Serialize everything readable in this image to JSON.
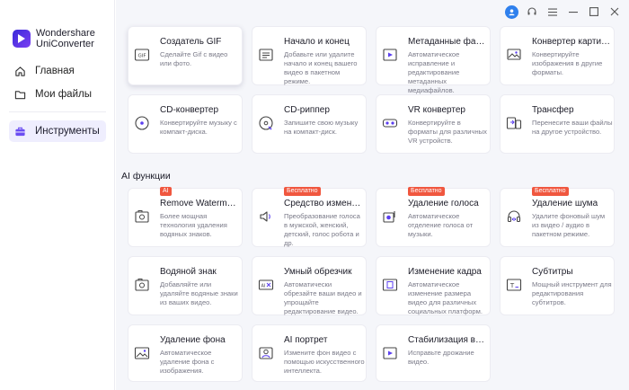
{
  "app": {
    "brand_line1": "Wondershare",
    "brand_line2": "UniConverter"
  },
  "sidebar": {
    "items": [
      {
        "label": "Главная",
        "icon": "home-icon"
      },
      {
        "label": "Мои файлы",
        "icon": "folder-icon"
      },
      {
        "label": "Инструменты",
        "icon": "toolbox-icon",
        "active": true
      }
    ]
  },
  "titlebar": {
    "icons": [
      "avatar-icon",
      "headset-icon",
      "menu-icon",
      "minimize-icon",
      "maximize-icon",
      "close-icon"
    ]
  },
  "tools": [
    {
      "title": "Создатель GIF",
      "desc": "Сделайте Gif с видео или фото.",
      "icon": "gif-icon"
    },
    {
      "title": "Начало и конец",
      "desc": "Добавьте или удалите начало и конец вашего видео в пакетном режиме.",
      "icon": "intro-outro-icon"
    },
    {
      "title": "Метаданные файла",
      "desc": "Автоматическое исправление и редактирование метаданных медиафайлов.",
      "icon": "metadata-icon"
    },
    {
      "title": "Конвертер картинок",
      "desc": "Конвертируйте изображения в другие форматы.",
      "icon": "image-convert-icon"
    },
    {
      "title": "CD-конвертер",
      "desc": "Конвертируйте музыку с компакт-диска.",
      "icon": "cd-convert-icon"
    },
    {
      "title": "CD-риппер",
      "desc": "Запишите свою музыку на компакт-диск.",
      "icon": "cd-ripper-icon"
    },
    {
      "title": "VR конвертер",
      "desc": "Конвертируйте в форматы для различных VR устройств.",
      "icon": "vr-icon"
    },
    {
      "title": "Трансфер",
      "desc": "Перенесите ваши файлы на другое устройство.",
      "icon": "transfer-icon"
    }
  ],
  "ai_section": {
    "title": "AI функции",
    "badge_ai": "AI",
    "badge_free": "Бесплатно",
    "tools": [
      {
        "title": "Remove Watermark",
        "title_display": "Remove Watermar...",
        "desc": "Более мощная технология удаления водяных знаков.",
        "icon": "watermark-remove-icon",
        "badge": "ai"
      },
      {
        "title": "Средство изменения голоса",
        "title_display": "Средство изменен...",
        "desc": "Преобразование голоса в мужской, женский, детский, голос робота и др.",
        "icon": "voice-changer-icon",
        "badge": "free"
      },
      {
        "title": "Удаление голоса",
        "title_display": "Удаление голоса",
        "desc": "Автоматическое отделение голоса от музыки.",
        "icon": "vocal-remover-icon",
        "badge": "free"
      },
      {
        "title": "Удаление шума",
        "title_display": "Удаление шума",
        "desc": "Удалите фоновый шум из видео / аудио в пакетном режиме.",
        "icon": "noise-remove-icon",
        "badge": "free"
      },
      {
        "title": "Водяной знак",
        "title_display": "Водяной знак",
        "desc": "Добавляйте или удаляйте водяные знаки из ваших видео.",
        "icon": "watermark-icon"
      },
      {
        "title": "Умный обрезчик",
        "title_display": "Умный обрезчик",
        "desc": "Автоматически обрезайте ваши видео и упрощайте редактирование видео.",
        "icon": "smart-trimmer-icon"
      },
      {
        "title": "Изменение кадра",
        "title_display": "Изменение кадра",
        "desc": "Автоматическое изменение размера видео для различных социальных платформ.",
        "icon": "reframe-icon"
      },
      {
        "title": "Субтитры",
        "title_display": "Субтитры",
        "desc": "Мощный инструмент для редактирования субтитров.",
        "icon": "subtitle-icon"
      },
      {
        "title": "Удаление фона",
        "title_display": "Удаление фона",
        "desc": "Автоматическое удаление фона с изображения.",
        "icon": "bg-remove-icon"
      },
      {
        "title": "AI портрет",
        "title_display": "AI портрет",
        "desc": "Измените фон видео с помощью искусственного интеллекта.",
        "icon": "ai-portrait-icon"
      },
      {
        "title": "Стабилизация видео",
        "title_display": "Стабилизация видео",
        "desc": "Исправьте дрожание видео.",
        "icon": "stabilization-icon"
      }
    ]
  },
  "colors": {
    "accent": "#5b3ff0",
    "badge": "#f0573f",
    "active_bg": "#efeefe"
  }
}
